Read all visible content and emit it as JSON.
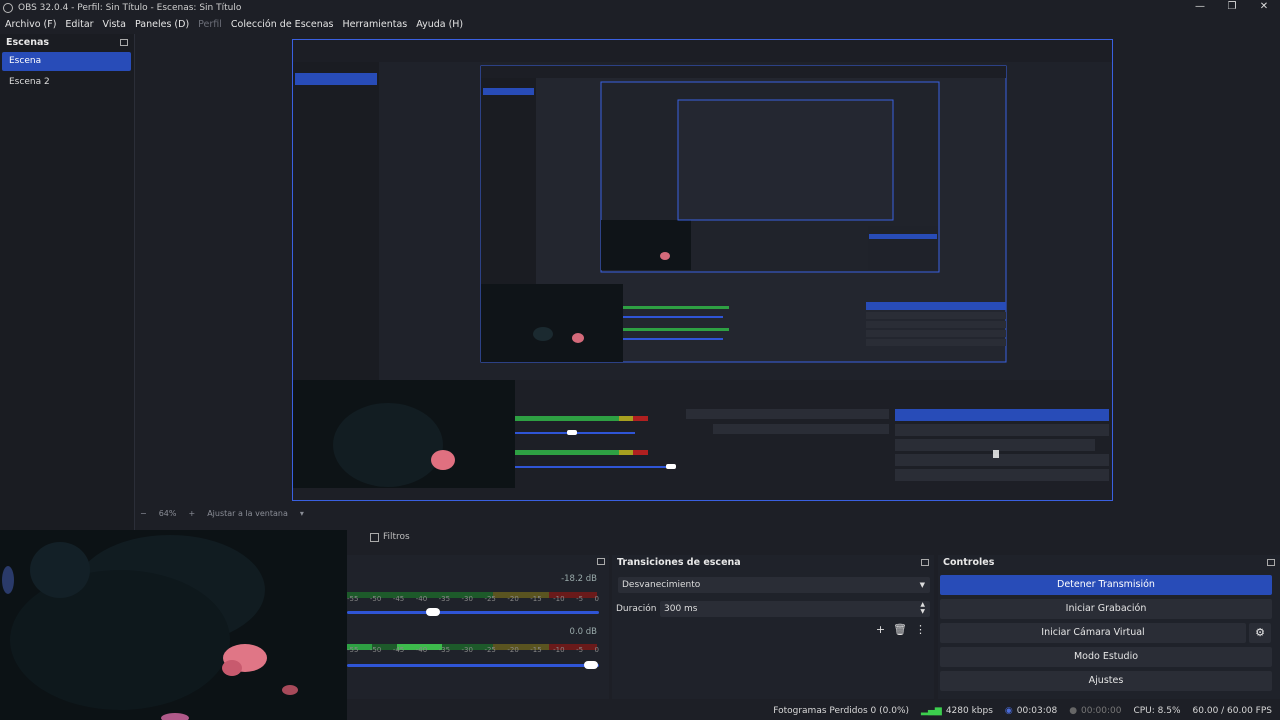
{
  "window": {
    "title": "OBS 32.0.4 - Perfil: Sin Título - Escenas: Sin Título",
    "controls": [
      "—",
      "❐",
      "✕"
    ]
  },
  "menu": {
    "items": [
      {
        "label": "Archivo (F)"
      },
      {
        "label": "Editar"
      },
      {
        "label": "Vista"
      },
      {
        "label": "Paneles (D)"
      },
      {
        "label": "Perfil"
      },
      {
        "label": "Colección de Escenas"
      },
      {
        "label": "Herramientas"
      },
      {
        "label": "Ayuda (H)"
      }
    ]
  },
  "scenes": {
    "title": "Escenas",
    "items": [
      {
        "label": "Escena"
      },
      {
        "label": "Escena 2"
      }
    ]
  },
  "preview": {
    "zoom": "64%",
    "fit_label": "Ajustar a la ventana"
  },
  "sources_tabs": {
    "filters_label": "Filtros"
  },
  "mixer": {
    "track1_db": "-18.2 dB",
    "track2_db": "0.0 dB",
    "ticks": [
      "-55",
      "-50",
      "-45",
      "-40",
      "-35",
      "-30",
      "-25",
      "-20",
      "-15",
      "-10",
      "-5",
      "0"
    ],
    "track1_volume": 0.34,
    "track2_volume": 0.97
  },
  "transitions": {
    "title": "Transiciones de escena",
    "selected": "Desvanecimiento",
    "duration_label": "Duración",
    "duration_value": "300 ms"
  },
  "controls": {
    "title": "Controles",
    "stop_stream": "Detener Transmisión",
    "start_recording": "Iniciar Grabación",
    "start_virtual_cam": "Iniciar Cámara Virtual",
    "studio_mode": "Modo Estudio",
    "settings": "Ajustes"
  },
  "status": {
    "dropped_frames": "Fotogramas Perdidos 0 (0.0%)",
    "bitrate": "4280 kbps",
    "stream_time": "00:03:08",
    "rec_time": "00:00:00",
    "cpu": "CPU: 8.5%",
    "fps": "60.00 / 60.00 FPS"
  },
  "colors": {
    "accent": "#284cb8",
    "preview_border": "#3a60e0",
    "meter_green": "#2ea043",
    "meter_yellow": "#a8a020",
    "meter_red": "#b02020"
  }
}
